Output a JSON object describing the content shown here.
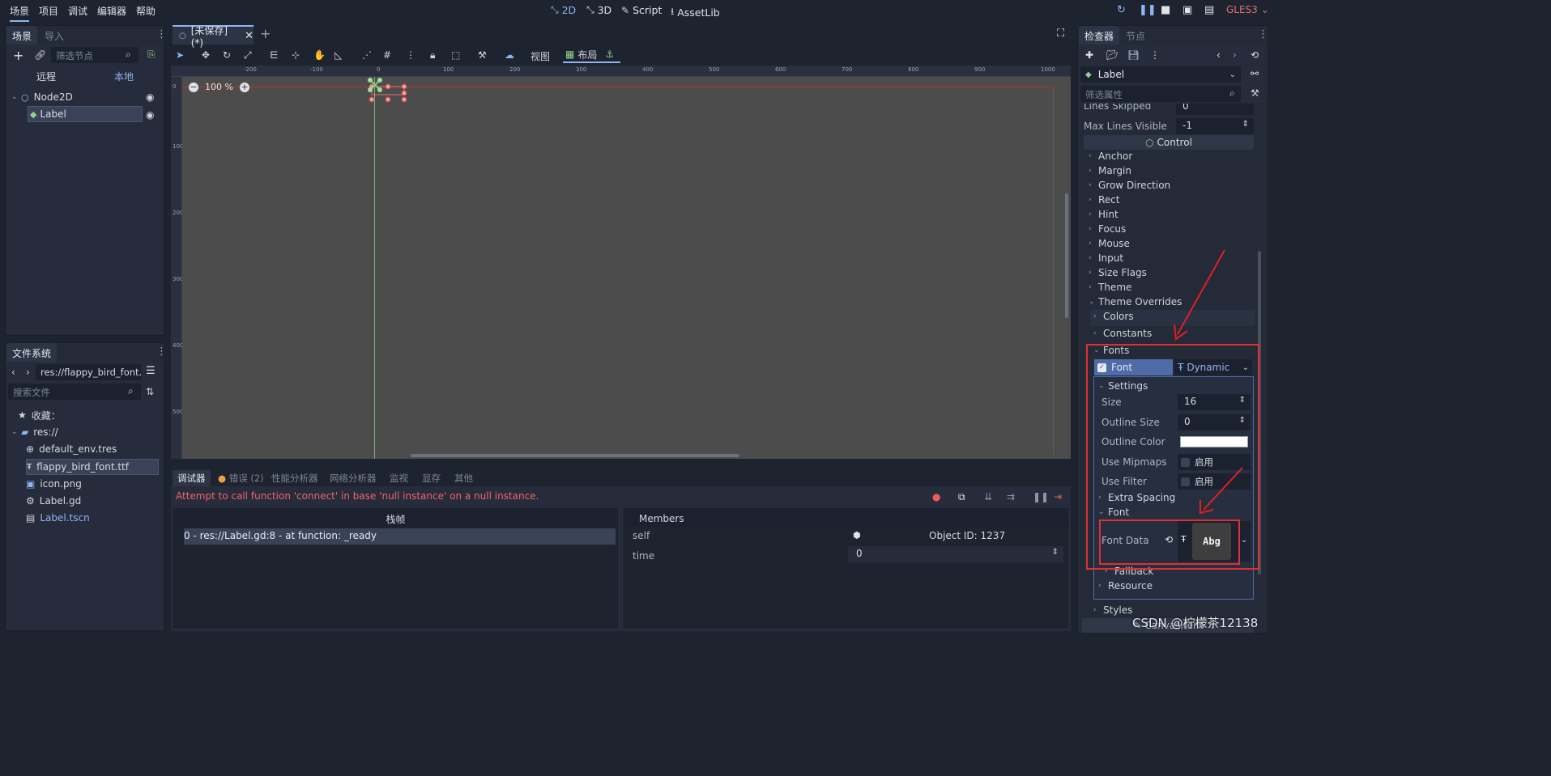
{
  "menu": [
    "场景",
    "项目",
    "调试",
    "编辑器",
    "帮助"
  ],
  "workspaces": [
    {
      "icon": "2d-icon",
      "label": "2D"
    },
    {
      "icon": "3d-icon",
      "label": "3D"
    },
    {
      "icon": "script-icon",
      "label": "Script"
    },
    {
      "icon": "assetlib-icon",
      "label": "AssetLib"
    }
  ],
  "renderer": "GLES3",
  "scene_dock": {
    "tabs": [
      "场景",
      "导入"
    ],
    "filter_placeholder": "筛选节点",
    "remote": "远程",
    "local": "本地",
    "tree": [
      {
        "label": "Node2D"
      },
      {
        "label": "Label"
      }
    ]
  },
  "fs_dock": {
    "title": "文件系统",
    "path": "res://flappy_bird_font.",
    "search_placeholder": "搜索文件",
    "favorites": "收藏：",
    "root": "res://",
    "files": [
      "default_env.tres",
      "flappy_bird_font.ttf",
      "icon.png",
      "Label.gd",
      "Label.tscn"
    ]
  },
  "editor_tab": "[未保存](*)",
  "viewport_toolbar": {
    "view": "视图",
    "layout": "布局",
    "zoom": "100 %"
  },
  "ruler_top": [
    "-200",
    "-100",
    "0",
    "100",
    "200",
    "300",
    "400",
    "500",
    "600",
    "700",
    "800",
    "900",
    "1000"
  ],
  "ruler_left": [
    "0",
    "100",
    "200",
    "300",
    "400",
    "500"
  ],
  "bottom": {
    "tabs": [
      "调试器",
      "错误 (2)",
      "性能分析器",
      "网络分析器",
      "监视",
      "显存",
      "其他"
    ],
    "error": "Attempt to call function 'connect' in base 'null instance' on a null instance.",
    "stack_header": "栈帧",
    "stack_row": "0 - res://Label.gd:8 - at function: _ready",
    "members_header": "Members",
    "members": [
      {
        "name": "self",
        "value": "Object ID: 1237"
      },
      {
        "name": "time",
        "value": "0"
      }
    ]
  },
  "inspector": {
    "tabs": [
      "检查器",
      "节点"
    ],
    "node": "Label",
    "filter_placeholder": "筛选属性",
    "lines_skipped": {
      "label": "Lines Skipped",
      "value": "0"
    },
    "max_lines": {
      "label": "Max Lines Visible",
      "value": "-1"
    },
    "section": "Control",
    "groups": [
      "Anchor",
      "Margin",
      "Grow Direction",
      "Rect",
      "Hint",
      "Focus",
      "Mouse",
      "Input",
      "Size Flags",
      "Theme",
      "Theme Overrides"
    ],
    "overrides": {
      "colors": "Colors",
      "constants": "Constants",
      "fonts": "Fonts",
      "styles": "Styles"
    },
    "font_label": "Font",
    "font_value": "Dynamic",
    "settings": "Settings",
    "size": {
      "label": "Size",
      "value": "16"
    },
    "outline_size": {
      "label": "Outline Size",
      "value": "0"
    },
    "outline_color": {
      "label": "Outline Color",
      "color": "#ffffff"
    },
    "use_mipmaps": {
      "label": "Use Mipmaps",
      "value": "启用"
    },
    "use_filter": {
      "label": "Use Filter",
      "value": "启用"
    },
    "extra_spacing": "Extra Spacing",
    "font_sub": "Font",
    "font_data": {
      "label": "Font Data",
      "preview": "Abg"
    },
    "fallback": "Fallback",
    "resource": "Resource",
    "bottom_cut": "CanvasItem"
  },
  "watermark": "CSDN @柠檬茶12138"
}
